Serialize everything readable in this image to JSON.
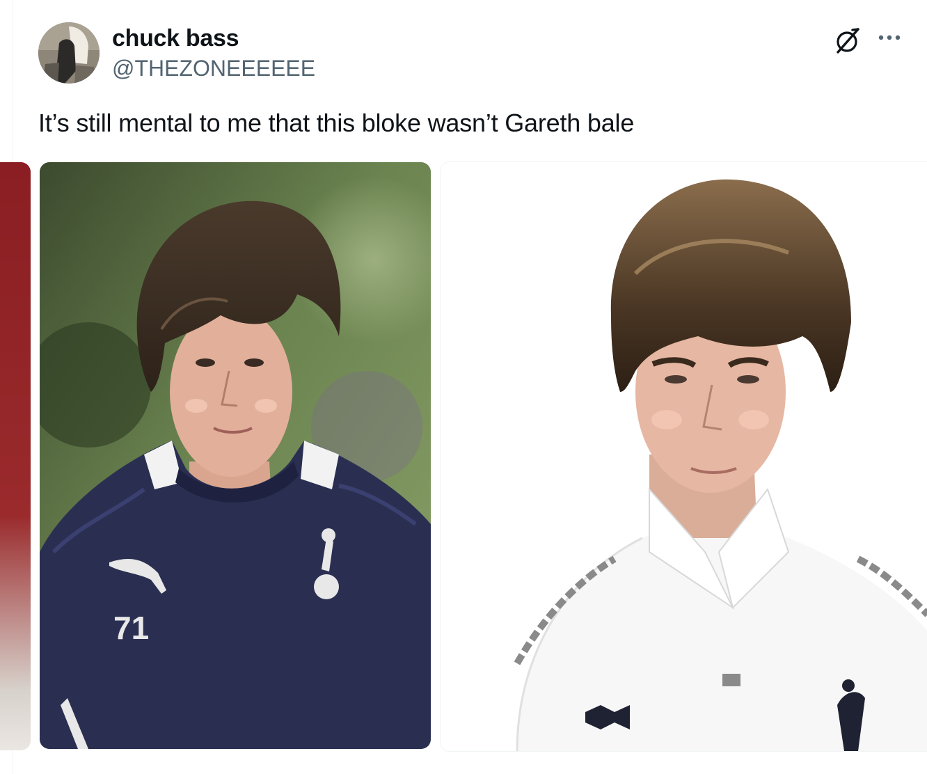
{
  "author": {
    "display_name": "chuck bass",
    "handle": "@THEZONEEEEEE",
    "avatar_icon": "user-avatar"
  },
  "actions": {
    "grok_icon": "grok-icon",
    "more_icon": "more-options-icon"
  },
  "tweet": {
    "text": "It’s still mental to me that this bloke wasn’t Gareth bale"
  },
  "media": {
    "left_photo": {
      "shirt_number": "71",
      "shirt_color": "#2a2f52",
      "background": "#4f6a3c"
    },
    "right_photo": {
      "shirt_color": "#f7f7f7",
      "background": "#ffffff"
    }
  },
  "colors": {
    "text_primary": "#0f1419",
    "text_secondary": "#536471",
    "border": "#eff3f4"
  }
}
